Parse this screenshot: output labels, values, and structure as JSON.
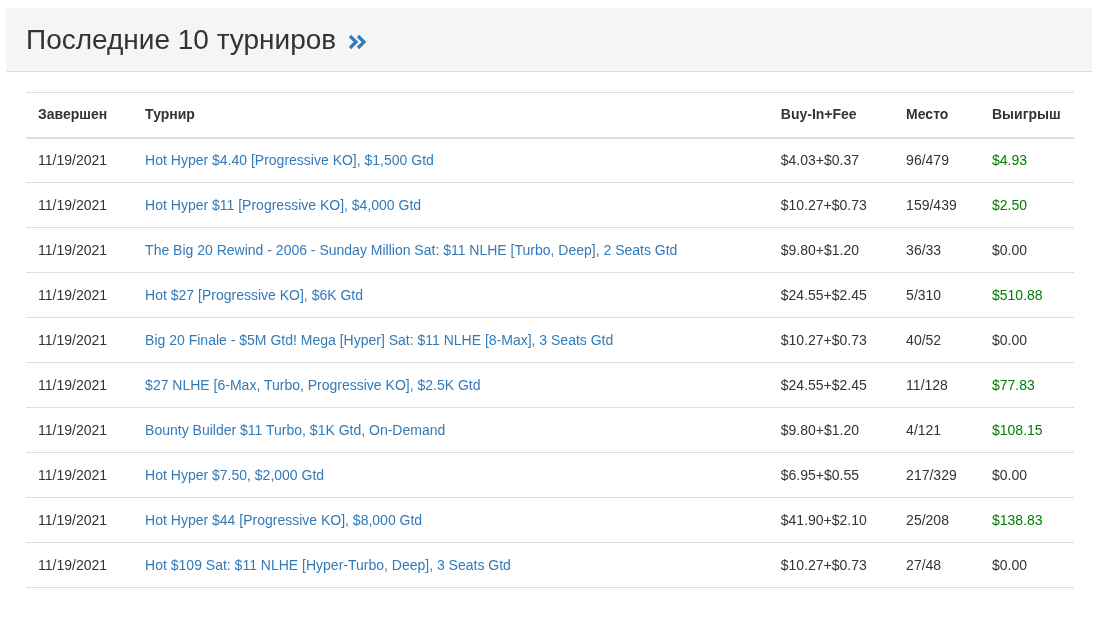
{
  "header": {
    "title": "Последние 10 турниров"
  },
  "table": {
    "columns": [
      "Завершен",
      "Турнир",
      "Buy-In+Fee",
      "Место",
      "Выигрыш"
    ],
    "rows": [
      {
        "finished": "11/19/2021",
        "tournament": "Hot Hyper $4.40 [Progressive KO], $1,500 Gtd",
        "buy_in": "$4.03+$0.37",
        "place": "96/479",
        "winnings": "$4.93",
        "won": true
      },
      {
        "finished": "11/19/2021",
        "tournament": "Hot Hyper $11 [Progressive KO], $4,000 Gtd",
        "buy_in": "$10.27+$0.73",
        "place": "159/439",
        "winnings": "$2.50",
        "won": true
      },
      {
        "finished": "11/19/2021",
        "tournament": "The Big 20 Rewind - 2006 - Sunday Million Sat: $11 NLHE [Turbo, Deep], 2 Seats Gtd",
        "buy_in": "$9.80+$1.20",
        "place": "36/33",
        "winnings": "$0.00",
        "won": false
      },
      {
        "finished": "11/19/2021",
        "tournament": "Hot $27 [Progressive KO], $6K Gtd",
        "buy_in": "$24.55+$2.45",
        "place": "5/310",
        "winnings": "$510.88",
        "won": true
      },
      {
        "finished": "11/19/2021",
        "tournament": "Big 20 Finale - $5M Gtd! Mega [Hyper] Sat: $11 NLHE [8-Max], 3 Seats Gtd",
        "buy_in": "$10.27+$0.73",
        "place": "40/52",
        "winnings": "$0.00",
        "won": false
      },
      {
        "finished": "11/19/2021",
        "tournament": "$27 NLHE [6-Max, Turbo, Progressive KO], $2.5K Gtd",
        "buy_in": "$24.55+$2.45",
        "place": "11/128",
        "winnings": "$77.83",
        "won": true
      },
      {
        "finished": "11/19/2021",
        "tournament": "Bounty Builder $11 Turbo, $1K Gtd, On-Demand",
        "buy_in": "$9.80+$1.20",
        "place": "4/121",
        "winnings": "$108.15",
        "won": true
      },
      {
        "finished": "11/19/2021",
        "tournament": "Hot Hyper $7.50, $2,000 Gtd",
        "buy_in": "$6.95+$0.55",
        "place": "217/329",
        "winnings": "$0.00",
        "won": false
      },
      {
        "finished": "11/19/2021",
        "tournament": "Hot Hyper $44 [Progressive KO], $8,000 Gtd",
        "buy_in": "$41.90+$2.10",
        "place": "25/208",
        "winnings": "$138.83",
        "won": true
      },
      {
        "finished": "11/19/2021",
        "tournament": "Hot $109 Sat: $11 NLHE [Hyper-Turbo, Deep], 3 Seats Gtd",
        "buy_in": "$10.27+$0.73",
        "place": "27/48",
        "winnings": "$0.00",
        "won": false
      }
    ]
  }
}
